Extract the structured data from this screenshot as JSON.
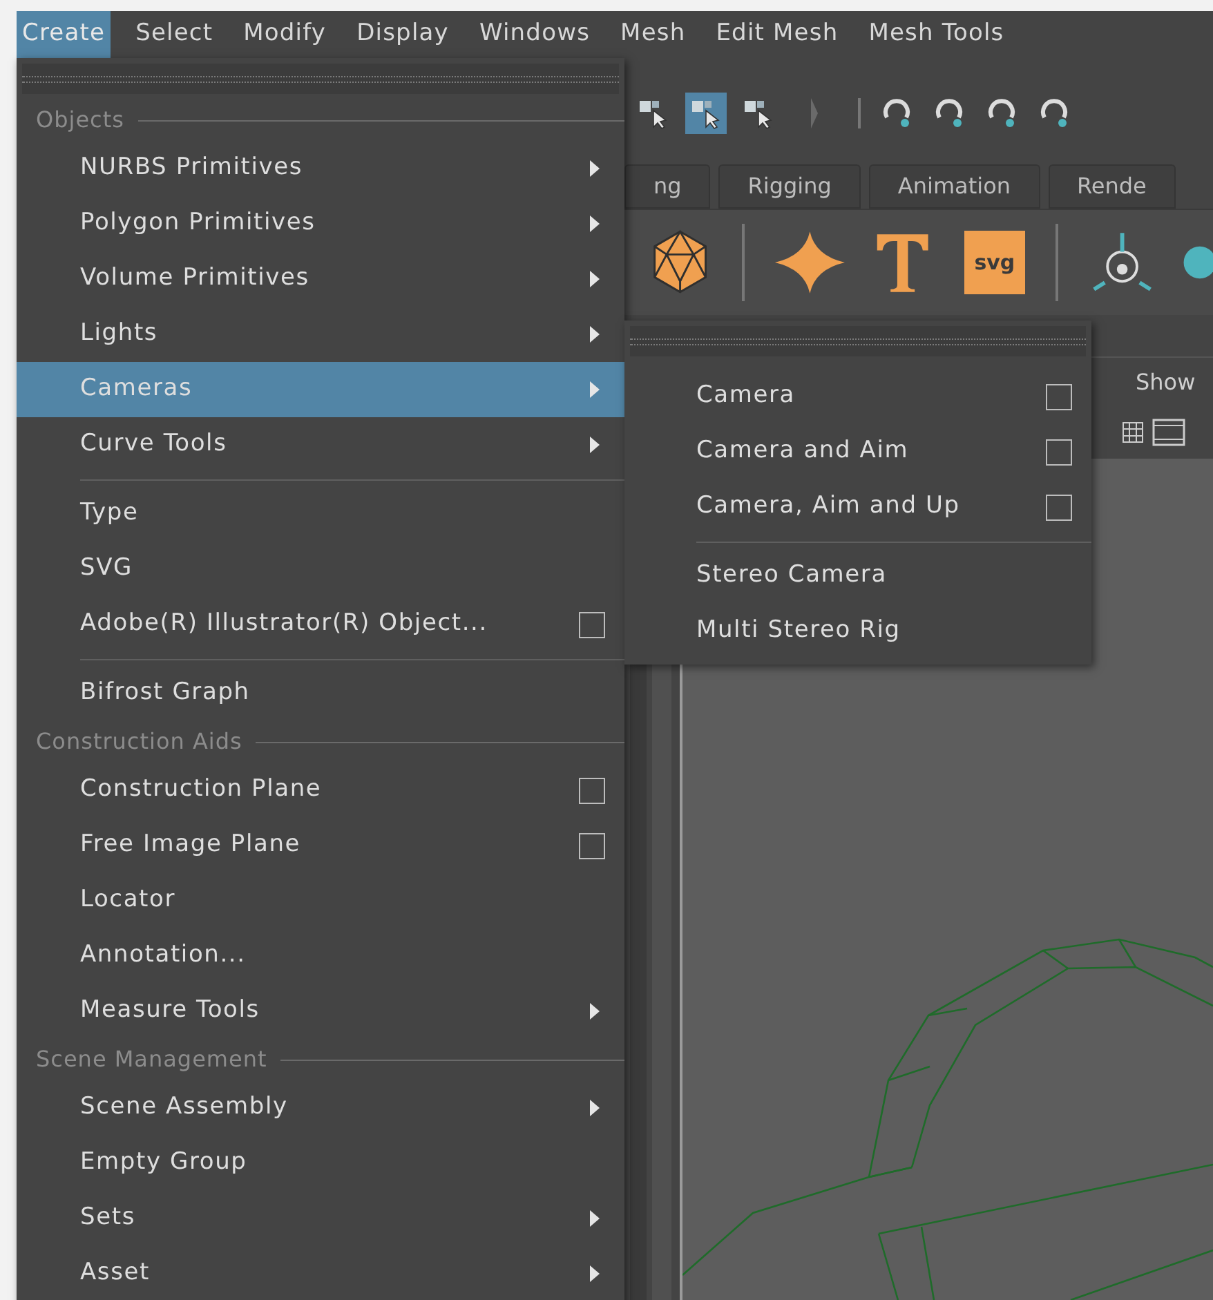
{
  "menubar": [
    {
      "label": "Create",
      "selected": true
    },
    {
      "label": "Select",
      "selected": false
    },
    {
      "label": "Modify",
      "selected": false
    },
    {
      "label": "Display",
      "selected": false
    },
    {
      "label": "Windows",
      "selected": false
    },
    {
      "label": "Mesh",
      "selected": false
    },
    {
      "label": "Edit Mesh",
      "selected": false
    },
    {
      "label": "Mesh Tools",
      "selected": false
    }
  ],
  "select_tools": [
    {
      "selected": false
    },
    {
      "selected": true
    },
    {
      "selected": false
    }
  ],
  "shelf_tabs": [
    "ng",
    "Rigging",
    "Animation",
    "Rende"
  ],
  "shelf_icon_label": "svg",
  "panel_menu": [
    "Show"
  ],
  "main_menu": {
    "entries": [
      {
        "kind": "header",
        "label": "Objects"
      },
      {
        "kind": "item",
        "label": "NURBS Primitives",
        "submenu": true,
        "option_box": false,
        "selected": false
      },
      {
        "kind": "item",
        "label": "Polygon Primitives",
        "submenu": true,
        "option_box": false,
        "selected": false
      },
      {
        "kind": "item",
        "label": "Volume Primitives",
        "submenu": true,
        "option_box": false,
        "selected": false
      },
      {
        "kind": "item",
        "label": "Lights",
        "submenu": true,
        "option_box": false,
        "selected": false
      },
      {
        "kind": "item",
        "label": "Cameras",
        "submenu": true,
        "option_box": false,
        "selected": true
      },
      {
        "kind": "item",
        "label": "Curve Tools",
        "submenu": true,
        "option_box": false,
        "selected": false
      },
      {
        "kind": "separator"
      },
      {
        "kind": "item",
        "label": "Type",
        "submenu": false,
        "option_box": false,
        "selected": false
      },
      {
        "kind": "item",
        "label": "SVG",
        "submenu": false,
        "option_box": false,
        "selected": false
      },
      {
        "kind": "item",
        "label": "Adobe(R) Illustrator(R) Object...",
        "submenu": false,
        "option_box": true,
        "selected": false
      },
      {
        "kind": "separator"
      },
      {
        "kind": "item",
        "label": "Bifrost Graph",
        "submenu": false,
        "option_box": false,
        "selected": false
      },
      {
        "kind": "header",
        "label": "Construction Aids"
      },
      {
        "kind": "item",
        "label": "Construction Plane",
        "submenu": false,
        "option_box": true,
        "selected": false
      },
      {
        "kind": "item",
        "label": "Free Image Plane",
        "submenu": false,
        "option_box": true,
        "selected": false
      },
      {
        "kind": "item",
        "label": "Locator",
        "submenu": false,
        "option_box": false,
        "selected": false
      },
      {
        "kind": "item",
        "label": "Annotation...",
        "submenu": false,
        "option_box": false,
        "selected": false
      },
      {
        "kind": "item",
        "label": "Measure Tools",
        "submenu": true,
        "option_box": false,
        "selected": false
      },
      {
        "kind": "header",
        "label": "Scene Management"
      },
      {
        "kind": "item",
        "label": "Scene Assembly",
        "submenu": true,
        "option_box": false,
        "selected": false
      },
      {
        "kind": "item",
        "label": "Empty Group",
        "submenu": false,
        "option_box": false,
        "selected": false
      },
      {
        "kind": "item",
        "label": "Sets",
        "submenu": true,
        "option_box": false,
        "selected": false
      },
      {
        "kind": "item",
        "label": "Asset",
        "submenu": true,
        "option_box": false,
        "selected": false
      }
    ]
  },
  "submenu": {
    "entries": [
      {
        "kind": "item",
        "label": "Camera",
        "submenu": false,
        "option_box": true,
        "selected": false
      },
      {
        "kind": "item",
        "label": "Camera and Aim",
        "submenu": false,
        "option_box": true,
        "selected": false
      },
      {
        "kind": "item",
        "label": "Camera, Aim and Up",
        "submenu": false,
        "option_box": true,
        "selected": false
      },
      {
        "kind": "separator"
      },
      {
        "kind": "item",
        "label": "Stereo Camera",
        "submenu": false,
        "option_box": false,
        "selected": false
      },
      {
        "kind": "item",
        "label": "Multi Stereo Rig",
        "submenu": false,
        "option_box": false,
        "selected": false
      }
    ]
  }
}
